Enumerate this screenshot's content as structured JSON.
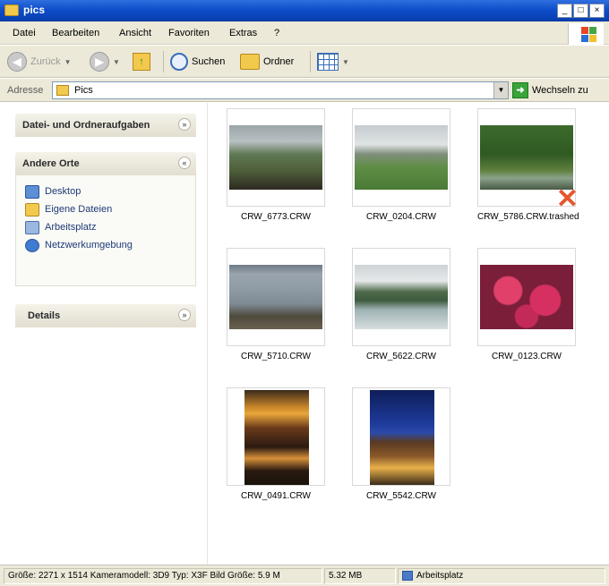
{
  "window": {
    "title": "pics"
  },
  "menu": [
    "Datei",
    "Bearbeiten",
    "Ansicht",
    "Favoriten",
    "Extras",
    "?"
  ],
  "toolbar": {
    "back": "Zurück",
    "search": "Suchen",
    "folders": "Ordner"
  },
  "address": {
    "label": "Adresse",
    "value": "Pics",
    "go": "Wechseln zu"
  },
  "taskpane": {
    "file_tasks_title": "Datei- und Ordneraufgaben",
    "other_places_title": "Andere Orte",
    "places": [
      "Desktop",
      "Eigene Dateien",
      "Arbeitsplatz",
      "Netzwerkumgebung"
    ],
    "details_title": "Details"
  },
  "files": [
    {
      "name": "CRW_6773.CRW"
    },
    {
      "name": "CRW_0204.CRW"
    },
    {
      "name": "CRW_5786.CRW.trashed"
    },
    {
      "name": "CRW_5710.CRW"
    },
    {
      "name": "CRW_5622.CRW"
    },
    {
      "name": "CRW_0123.CRW"
    },
    {
      "name": "CRW_0491.CRW"
    },
    {
      "name": "CRW_5542.CRW"
    }
  ],
  "status": {
    "details": "Größe: 2271 x 1514 Kameramodell: 3D9 Typ: X3F Bild Größe: 5.9 M",
    "size": "5.32 MB",
    "zone": "Arbeitsplatz"
  }
}
